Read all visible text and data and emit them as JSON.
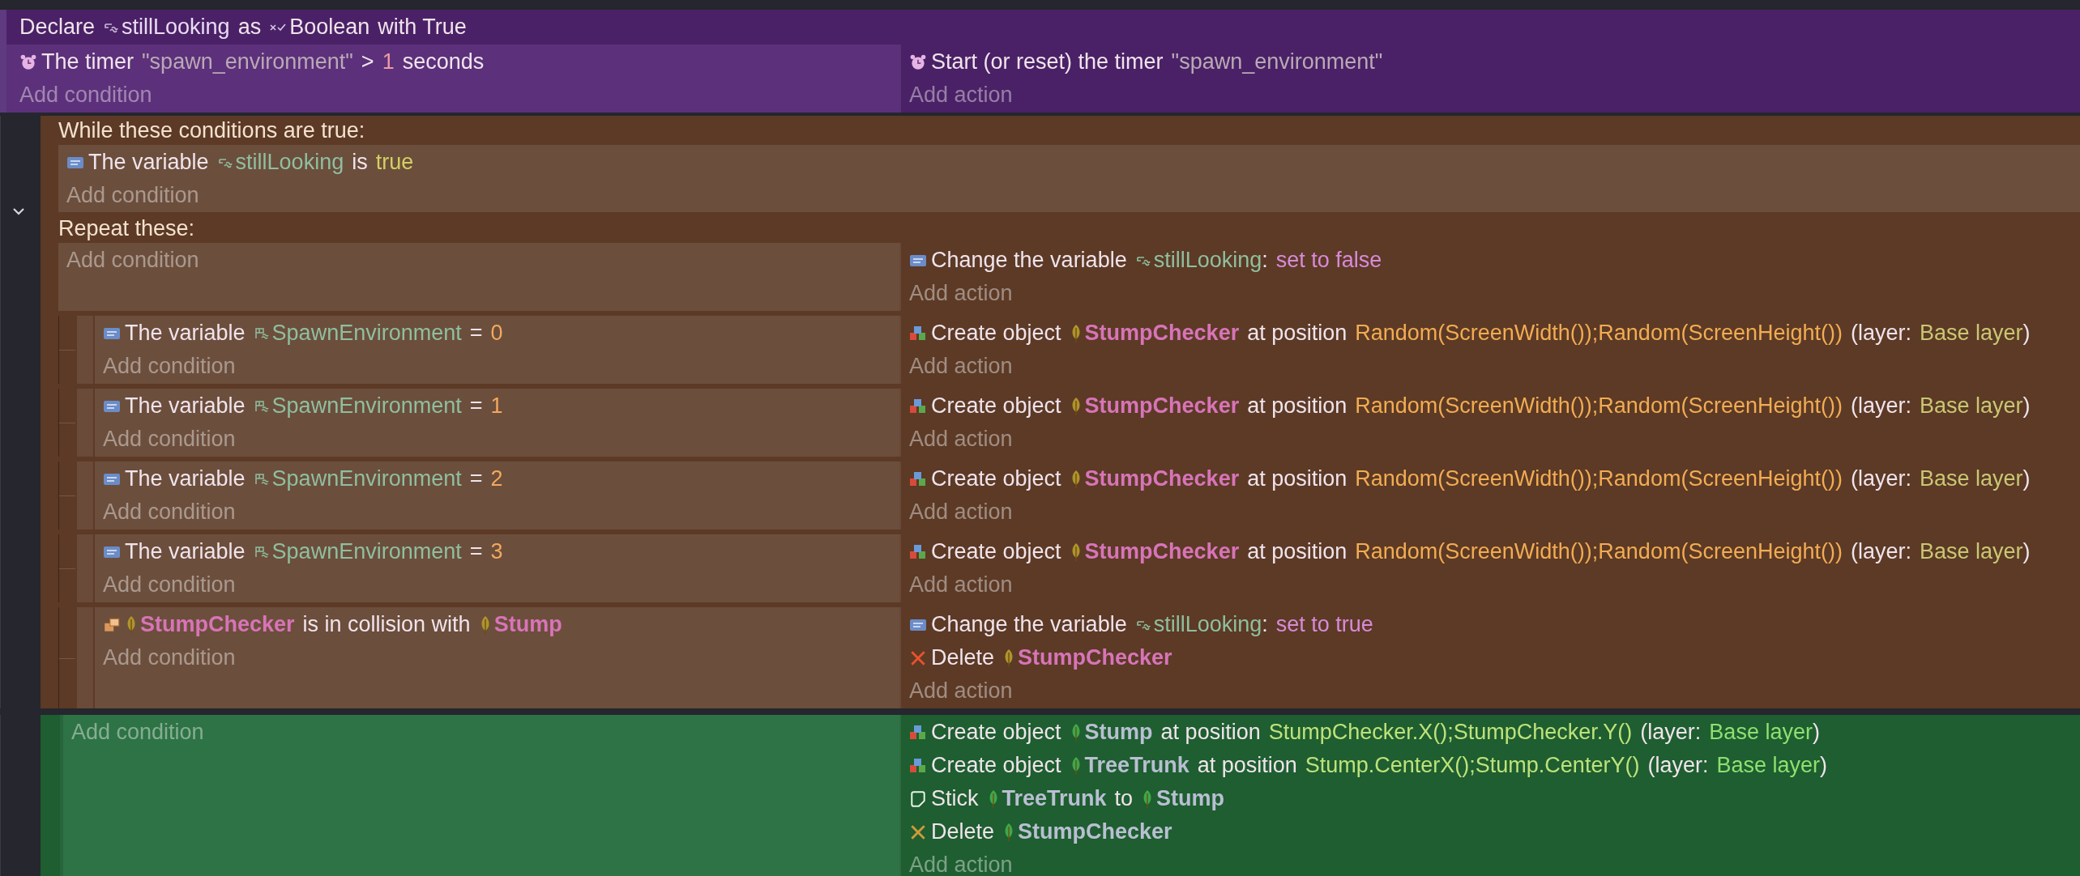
{
  "events": [
    {
      "kind": "standard",
      "color": "#4a2166",
      "declaration": [
        {
          "kind": "text",
          "text": "Declare"
        },
        {
          "kind": "var",
          "text": "stillLooking"
        },
        {
          "kind": "text",
          "text": "as"
        },
        {
          "kind": "type",
          "text": "Boolean"
        },
        {
          "kind": "text",
          "text": "with True"
        }
      ],
      "conditions": [
        {
          "kind": "timer",
          "parts": [
            {
              "kind": "text",
              "text": "The timer"
            },
            {
              "kind": "str",
              "text": "\"spawn_environment\""
            },
            {
              "kind": "text",
              "text": ">"
            },
            {
              "kind": "num2",
              "text": "1"
            },
            {
              "kind": "text",
              "text": "seconds"
            }
          ]
        }
      ],
      "add_condition": "Add condition",
      "actions": [
        {
          "kind": "timer",
          "parts": [
            {
              "kind": "text",
              "text": "Start (or reset) the timer"
            },
            {
              "kind": "str",
              "text": "\"spawn_environment\""
            }
          ]
        }
      ],
      "add_action": "Add action"
    },
    {
      "kind": "while",
      "color": "#5c3a26",
      "while_label": "While these conditions are true:",
      "while_conditions": [
        {
          "kind": "variable",
          "parts": [
            {
              "kind": "text",
              "text": "The variable"
            },
            {
              "kind": "var",
              "text": "stillLooking"
            },
            {
              "kind": "text",
              "text": "is"
            },
            {
              "kind": "kw",
              "text": "true"
            }
          ]
        }
      ],
      "add_while_condition": "Add condition",
      "repeat_label": "Repeat these:",
      "add_condition": "Add condition",
      "actions": [
        {
          "kind": "variable",
          "parts": [
            {
              "kind": "text",
              "text": "Change the variable"
            },
            {
              "kind": "var",
              "text": "stillLooking"
            },
            {
              "kind": "punct",
              "text": ":"
            },
            {
              "kind": "val",
              "text": "set to false"
            }
          ]
        }
      ],
      "add_action": "Add action",
      "children": [
        {
          "conditions": [
            {
              "kind": "variable",
              "parts": [
                {
                  "kind": "text",
                  "text": "The variable"
                },
                {
                  "kind": "scene-var",
                  "text": "SpawnEnvironment"
                },
                {
                  "kind": "text",
                  "text": "="
                },
                {
                  "kind": "num",
                  "text": "0"
                }
              ]
            }
          ],
          "add_condition": "Add condition",
          "actions": [
            {
              "kind": "create",
              "parts": [
                {
                  "kind": "text",
                  "text": "Create object"
                },
                {
                  "kind": "obj",
                  "text": "StumpChecker"
                },
                {
                  "kind": "text",
                  "text": "at position"
                },
                {
                  "kind": "expr",
                  "text": "Random(ScreenWidth());Random(ScreenHeight())"
                },
                {
                  "kind": "text",
                  "text": "(layer:"
                },
                {
                  "kind": "layer",
                  "text": "Base layer"
                },
                {
                  "kind": "punct",
                  "text": ")"
                }
              ]
            }
          ],
          "add_action": "Add action"
        },
        {
          "conditions": [
            {
              "kind": "variable",
              "parts": [
                {
                  "kind": "text",
                  "text": "The variable"
                },
                {
                  "kind": "scene-var",
                  "text": "SpawnEnvironment"
                },
                {
                  "kind": "text",
                  "text": "="
                },
                {
                  "kind": "num",
                  "text": "1"
                }
              ]
            }
          ],
          "add_condition": "Add condition",
          "actions": [
            {
              "kind": "create",
              "parts": [
                {
                  "kind": "text",
                  "text": "Create object"
                },
                {
                  "kind": "obj",
                  "text": "StumpChecker"
                },
                {
                  "kind": "text",
                  "text": "at position"
                },
                {
                  "kind": "expr",
                  "text": "Random(ScreenWidth());Random(ScreenHeight())"
                },
                {
                  "kind": "text",
                  "text": "(layer:"
                },
                {
                  "kind": "layer",
                  "text": "Base layer"
                },
                {
                  "kind": "punct",
                  "text": ")"
                }
              ]
            }
          ],
          "add_action": "Add action"
        },
        {
          "conditions": [
            {
              "kind": "variable",
              "parts": [
                {
                  "kind": "text",
                  "text": "The variable"
                },
                {
                  "kind": "scene-var",
                  "text": "SpawnEnvironment"
                },
                {
                  "kind": "text",
                  "text": "="
                },
                {
                  "kind": "num",
                  "text": "2"
                }
              ]
            }
          ],
          "add_condition": "Add condition",
          "actions": [
            {
              "kind": "create",
              "parts": [
                {
                  "kind": "text",
                  "text": "Create object"
                },
                {
                  "kind": "obj",
                  "text": "StumpChecker"
                },
                {
                  "kind": "text",
                  "text": "at position"
                },
                {
                  "kind": "expr",
                  "text": "Random(ScreenWidth());Random(ScreenHeight())"
                },
                {
                  "kind": "text",
                  "text": "(layer:"
                },
                {
                  "kind": "layer",
                  "text": "Base layer"
                },
                {
                  "kind": "punct",
                  "text": ")"
                }
              ]
            }
          ],
          "add_action": "Add action"
        },
        {
          "conditions": [
            {
              "kind": "variable",
              "parts": [
                {
                  "kind": "text",
                  "text": "The variable"
                },
                {
                  "kind": "scene-var",
                  "text": "SpawnEnvironment"
                },
                {
                  "kind": "text",
                  "text": "="
                },
                {
                  "kind": "num",
                  "text": "3"
                }
              ]
            }
          ],
          "add_condition": "Add condition",
          "actions": [
            {
              "kind": "create",
              "parts": [
                {
                  "kind": "text",
                  "text": "Create object"
                },
                {
                  "kind": "obj",
                  "text": "StumpChecker"
                },
                {
                  "kind": "text",
                  "text": "at position"
                },
                {
                  "kind": "expr",
                  "text": "Random(ScreenWidth());Random(ScreenHeight())"
                },
                {
                  "kind": "text",
                  "text": "(layer:"
                },
                {
                  "kind": "layer",
                  "text": "Base layer"
                },
                {
                  "kind": "punct",
                  "text": ")"
                }
              ]
            }
          ],
          "add_action": "Add action"
        },
        {
          "conditions": [
            {
              "kind": "collision",
              "parts": [
                {
                  "kind": "obj",
                  "text": "StumpChecker"
                },
                {
                  "kind": "text",
                  "text": "is in collision with"
                },
                {
                  "kind": "obj",
                  "text": "Stump"
                }
              ]
            }
          ],
          "add_condition": "Add condition",
          "actions": [
            {
              "kind": "variable",
              "parts": [
                {
                  "kind": "text",
                  "text": "Change the variable"
                },
                {
                  "kind": "var",
                  "text": "stillLooking"
                },
                {
                  "kind": "punct",
                  "text": ":"
                },
                {
                  "kind": "val",
                  "text": "set to true"
                }
              ]
            },
            {
              "kind": "delete",
              "parts": [
                {
                  "kind": "text",
                  "text": "Delete"
                },
                {
                  "kind": "obj",
                  "text": "StumpChecker"
                }
              ]
            }
          ],
          "add_action": "Add action"
        }
      ]
    },
    {
      "kind": "standard",
      "color": "#1e5e30",
      "add_condition": "Add condition",
      "actions": [
        {
          "kind": "create",
          "parts": [
            {
              "kind": "text",
              "text": "Create object"
            },
            {
              "kind": "obj2",
              "text": "Stump"
            },
            {
              "kind": "text",
              "text": "at position"
            },
            {
              "kind": "expr2",
              "text": "StumpChecker.X();StumpChecker.Y()"
            },
            {
              "kind": "text",
              "text": "(layer:"
            },
            {
              "kind": "layer2",
              "text": "Base layer"
            },
            {
              "kind": "punct",
              "text": ")"
            }
          ]
        },
        {
          "kind": "create",
          "parts": [
            {
              "kind": "text",
              "text": "Create object"
            },
            {
              "kind": "obj2",
              "text": "TreeTrunk"
            },
            {
              "kind": "text",
              "text": "at position"
            },
            {
              "kind": "expr2",
              "text": "Stump.CenterX();Stump.CenterY()"
            },
            {
              "kind": "text",
              "text": "(layer:"
            },
            {
              "kind": "layer2",
              "text": "Base layer"
            },
            {
              "kind": "punct",
              "text": ")"
            }
          ]
        },
        {
          "kind": "stick",
          "parts": [
            {
              "kind": "text",
              "text": "Stick"
            },
            {
              "kind": "obj2",
              "text": "TreeTrunk"
            },
            {
              "kind": "text",
              "text": "to"
            },
            {
              "kind": "obj2",
              "text": "Stump"
            }
          ]
        },
        {
          "kind": "delete-muted",
          "parts": [
            {
              "kind": "text",
              "text": "Delete"
            },
            {
              "kind": "obj2",
              "text": "StumpChecker"
            }
          ]
        }
      ],
      "add_action": "Add action"
    }
  ]
}
